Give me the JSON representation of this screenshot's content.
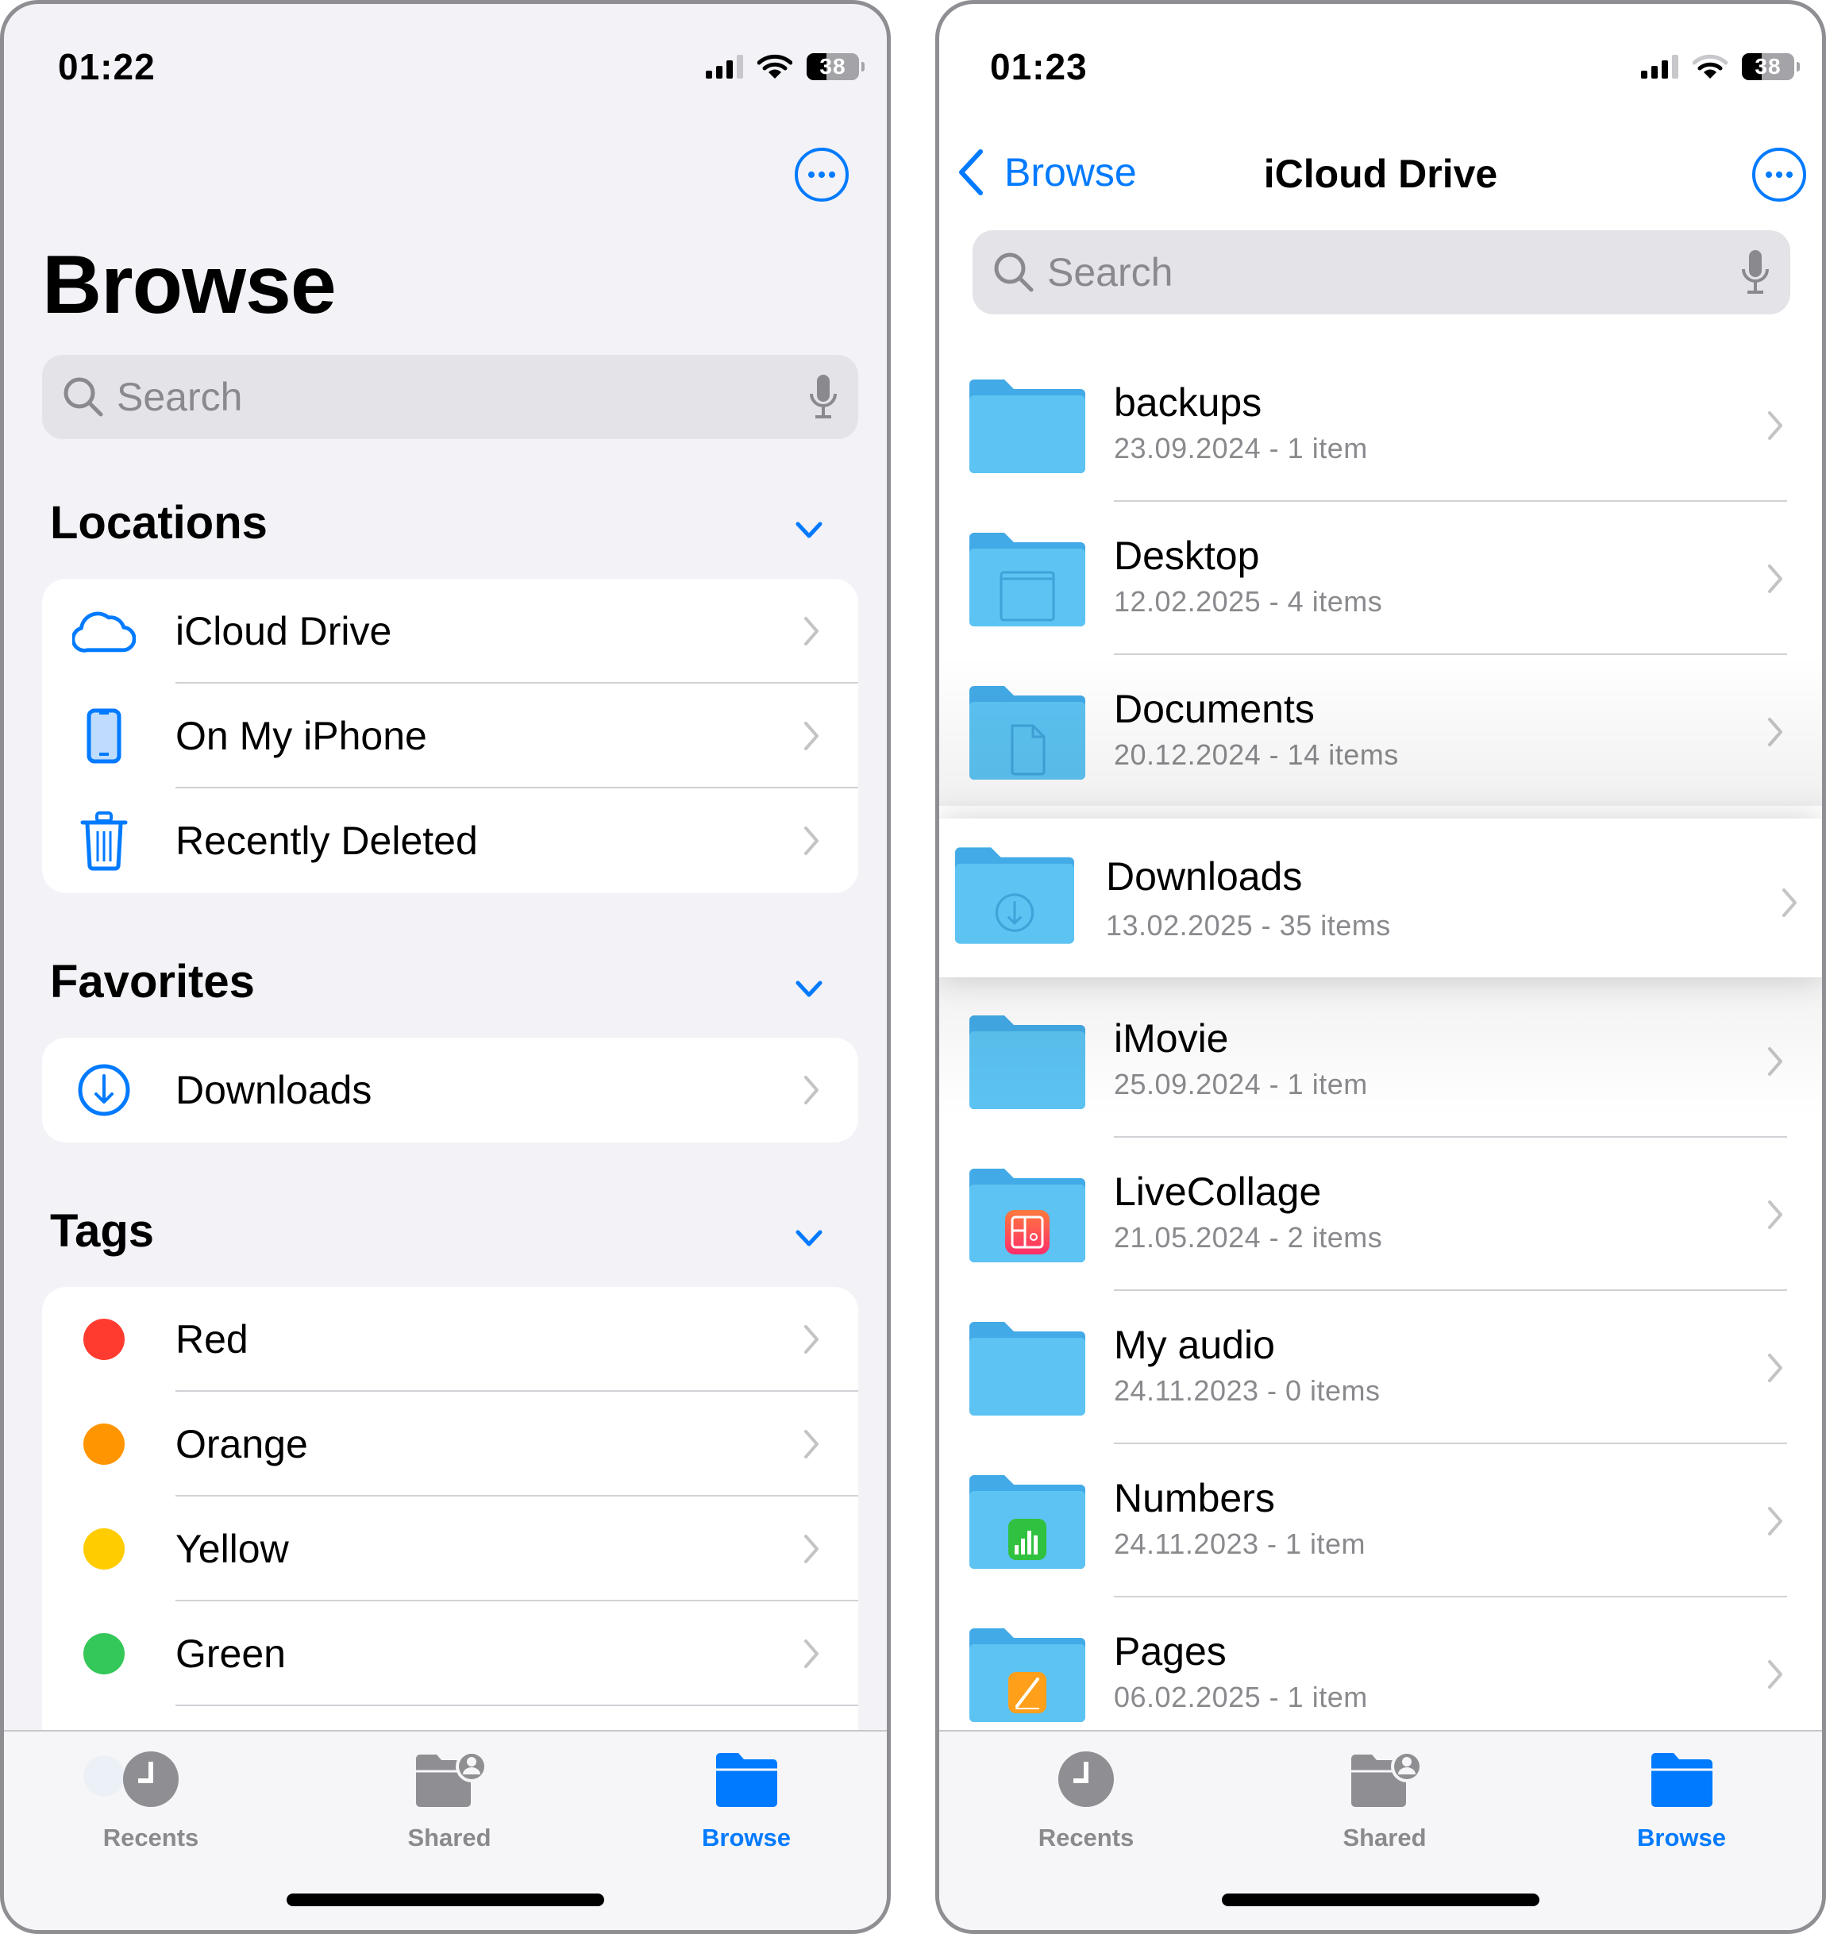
{
  "left_screen": {
    "status": {
      "time": "01:22",
      "signal_bars_active": 3,
      "signal_bars_total": 4,
      "wifi_arcs_active": 3,
      "battery_percent": 38,
      "battery_label": "38"
    },
    "title": "Browse",
    "search": {
      "placeholder": "Search"
    },
    "sections": {
      "locations": {
        "title": "Locations",
        "items": [
          {
            "label": "iCloud Drive",
            "icon": "cloud-icon"
          },
          {
            "label": "On My iPhone",
            "icon": "iphone-icon"
          },
          {
            "label": "Recently Deleted",
            "icon": "trash-icon"
          }
        ]
      },
      "favorites": {
        "title": "Favorites",
        "items": [
          {
            "label": "Downloads",
            "icon": "download-circle-icon"
          }
        ]
      },
      "tags": {
        "title": "Tags",
        "items": [
          {
            "label": "Red",
            "color": "#ff3b30"
          },
          {
            "label": "Orange",
            "color": "#ff9500"
          },
          {
            "label": "Yellow",
            "color": "#ffcc00"
          },
          {
            "label": "Green",
            "color": "#34c759"
          },
          {
            "label": "",
            "color": "#007aff"
          }
        ]
      }
    },
    "tabbar": {
      "tabs": [
        {
          "label": "Recents",
          "icon": "clock-icon",
          "active": false
        },
        {
          "label": "Shared",
          "icon": "shared-folder-icon",
          "active": false
        },
        {
          "label": "Browse",
          "icon": "folder-icon",
          "active": true
        }
      ]
    }
  },
  "right_screen": {
    "status": {
      "time": "01:23",
      "signal_bars_active": 3,
      "signal_bars_total": 4,
      "wifi_arcs_active": 2,
      "battery_percent": 38,
      "battery_label": "38"
    },
    "nav": {
      "back_label": "Browse",
      "title": "iCloud Drive"
    },
    "search": {
      "placeholder": "Search"
    },
    "files": [
      {
        "name": "backups",
        "meta": "23.09.2024 - 1 item",
        "badge": "none"
      },
      {
        "name": "Desktop",
        "meta": "12.02.2025 - 4 items",
        "badge": "desktop"
      },
      {
        "name": "Documents",
        "meta": "20.12.2024 - 14 items",
        "badge": "document"
      },
      {
        "name": "Downloads",
        "meta": "13.02.2025 - 35 items",
        "badge": "download",
        "lifted": true
      },
      {
        "name": "iMovie",
        "meta": "25.09.2024 - 1 item",
        "badge": "none"
      },
      {
        "name": "LiveCollage",
        "meta": "21.05.2024 - 2 items",
        "badge": "livecollage"
      },
      {
        "name": "My audio",
        "meta": "24.11.2023 - 0 items",
        "badge": "none"
      },
      {
        "name": "Numbers",
        "meta": "24.11.2023 - 1 item",
        "badge": "numbers"
      },
      {
        "name": "Pages",
        "meta": "06.02.2025 - 1 item",
        "badge": "pages"
      }
    ],
    "tabbar": {
      "tabs": [
        {
          "label": "Recents",
          "icon": "clock-icon",
          "active": false
        },
        {
          "label": "Shared",
          "icon": "shared-folder-icon",
          "active": false
        },
        {
          "label": "Browse",
          "icon": "folder-icon",
          "active": true
        }
      ]
    }
  },
  "colors": {
    "accent": "#007aff",
    "folder": "#5ac0f0",
    "secondary_text": "#8a8a8e",
    "grouped_bg": "#f2f2f7"
  }
}
